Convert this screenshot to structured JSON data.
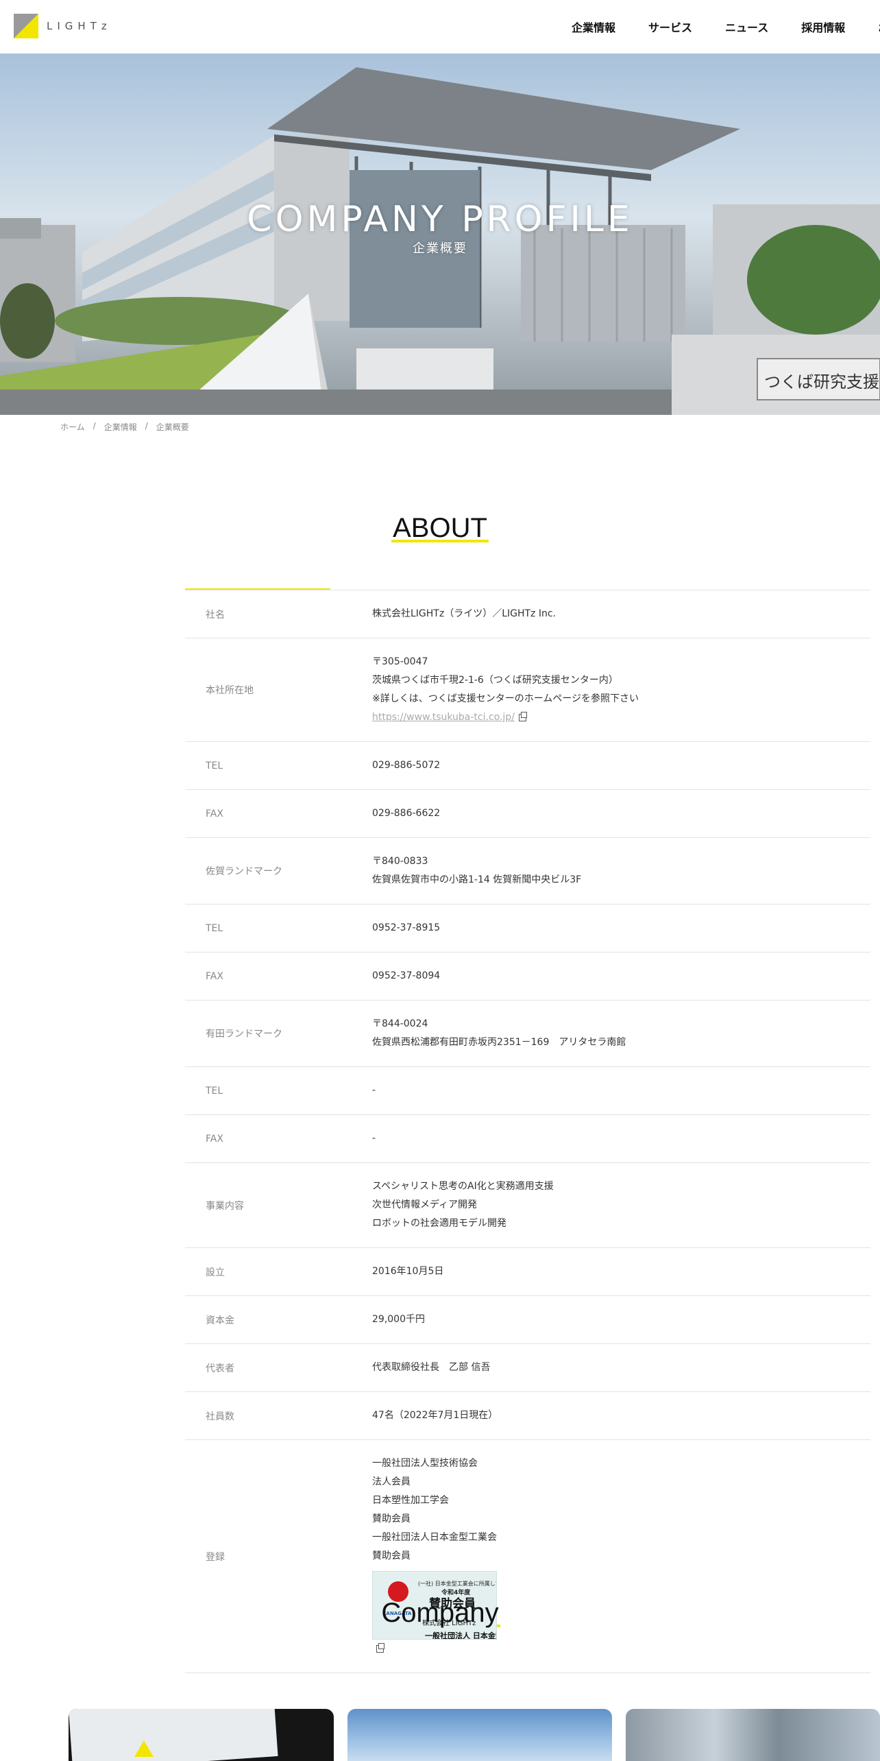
{
  "header": {
    "logo_text": "LIGHTz",
    "nav": [
      "企業情報",
      "サービス",
      "ニュース",
      "採用情報",
      "お問"
    ]
  },
  "hero": {
    "title": "COMPANY PROFILE",
    "subtitle": "企業概要",
    "sign_text": "つくば研究支援セ"
  },
  "breadcrumb": [
    "ホーム",
    "企業情報",
    "企業概要"
  ],
  "about": {
    "heading": "ABOUT",
    "rows": [
      {
        "label": "社名",
        "lines": [
          "株式会社LIGHTz（ライツ）／LIGHTz Inc."
        ]
      },
      {
        "label": "本社所在地",
        "lines": [
          "〒305-0047",
          "茨城県つくば市千現2-1-6（つくば研究支援センター内）",
          "※詳しくは、つくば支援センターのホームページを参照下さい"
        ],
        "link": "https://www.tsukuba-tci.co.jp/"
      },
      {
        "label": "TEL",
        "lines": [
          "029-886-5072"
        ]
      },
      {
        "label": "FAX",
        "lines": [
          "029-886-6622"
        ]
      },
      {
        "label": "佐賀ランドマーク",
        "lines": [
          "〒840-0833",
          "佐賀県佐賀市中の小路1-14 佐賀新聞中央ビル3F"
        ]
      },
      {
        "label": "TEL",
        "lines": [
          "0952-37-8915"
        ]
      },
      {
        "label": "FAX",
        "lines": [
          "0952-37-8094"
        ]
      },
      {
        "label": "有田ランドマーク",
        "lines": [
          "〒844-0024",
          "佐賀県西松浦郡有田町赤坂丙2351－169　アリタセラ南館"
        ]
      },
      {
        "label": "TEL",
        "lines": [
          "-"
        ]
      },
      {
        "label": "FAX",
        "lines": [
          "-"
        ]
      },
      {
        "label": "事業内容",
        "lines": [
          "スペシャリスト思考のAI化と実務適用支援",
          "次世代情報メディア開発",
          "ロボットの社会適用モデル開発"
        ]
      },
      {
        "label": "設立",
        "lines": [
          "2016年10月5日"
        ]
      },
      {
        "label": "資本金",
        "lines": [
          "29,000千円"
        ]
      },
      {
        "label": "代表者",
        "lines": [
          "代表取締役社長　乙部 信吾"
        ]
      },
      {
        "label": "社員数",
        "lines": [
          "47名（2022年7月1日現在）"
        ]
      },
      {
        "label": "登録",
        "lines": [
          "一般社団法人型技術協会",
          "法人会員",
          "日本塑性加工学会",
          "賛助会員",
          "一般社団法人日本金型工業会",
          "賛助会員"
        ],
        "badge": true
      }
    ],
    "badge": {
      "line1": "(一社) 日本金型工業会に所属しています",
      "line2": "令和4年度",
      "line3": "賛助会員",
      "line4": "株式会社 LIGHTz",
      "line5": "一般社団法人 日本金型工業会",
      "mark": "KANAGATA"
    }
  },
  "company": {
    "heading": "Company"
  },
  "colors": {
    "accent": "#f1e600",
    "border": "#e3e3e3",
    "label": "#888888"
  }
}
